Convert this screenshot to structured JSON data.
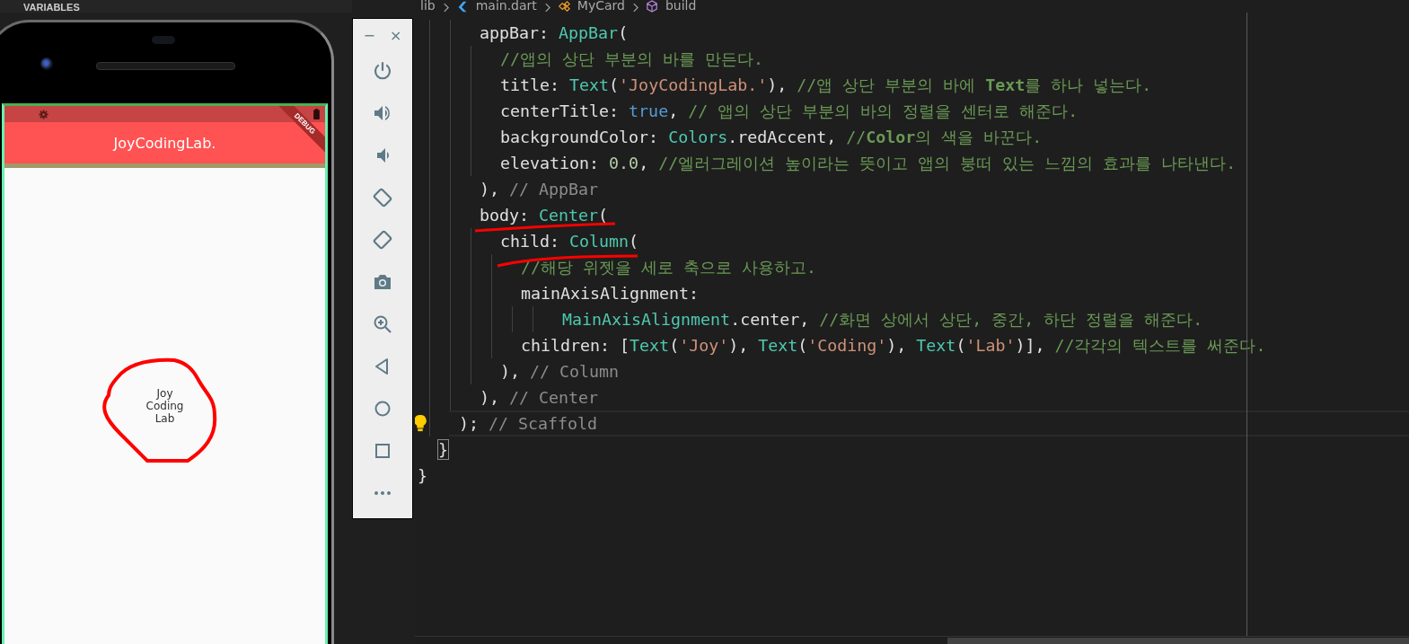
{
  "sidebar": {
    "header": "VARIABLES"
  },
  "breadcrumb": [
    {
      "label": "lib",
      "kind": "folder"
    },
    {
      "label": "main.dart",
      "kind": "file"
    },
    {
      "label": "MyCard",
      "kind": "class"
    },
    {
      "label": "build",
      "kind": "method"
    }
  ],
  "emulator": {
    "app_bar": {
      "title": "JoyCodingLab."
    },
    "debug_banner": "DEBUG",
    "body_texts": [
      "Joy",
      "Coding",
      "Lab"
    ]
  },
  "emulator_toolbar": {
    "minimize": "−",
    "close": "×",
    "buttons": [
      {
        "kind": "power"
      },
      {
        "kind": "volume-up"
      },
      {
        "kind": "volume-down"
      },
      {
        "kind": "rotate-left"
      },
      {
        "kind": "rotate-right"
      },
      {
        "kind": "camera"
      },
      {
        "kind": "zoom"
      },
      {
        "kind": "back"
      },
      {
        "kind": "home"
      },
      {
        "kind": "overview"
      },
      {
        "kind": "more"
      }
    ]
  },
  "editor": {
    "lines": [
      {
        "children": [
          {
            "children": [
              {
                "children": [
                  {
                    "tokens": [
                      {
                        "kind": "plain",
                        "t": "appBar: "
                      },
                      {
                        "kind": "type",
                        "t": "AppBar"
                      },
                      {
                        "kind": "plain",
                        "t": "("
                      }
                    ],
                    "children": [
                      {
                        "tokens": [
                          {
                            "kind": "comment",
                            "t": "//앱의 상단 부분의 바를 만든다."
                          }
                        ]
                      },
                      {
                        "tokens": [
                          {
                            "kind": "plain",
                            "t": "title: "
                          },
                          {
                            "kind": "type",
                            "t": "Text"
                          },
                          {
                            "kind": "plain",
                            "t": "("
                          },
                          {
                            "kind": "string",
                            "t": "'JoyCodingLab.'"
                          },
                          {
                            "kind": "plain",
                            "t": "), "
                          },
                          {
                            "kind": "comment",
                            "t": "//앱 상단 부분의 바에 **Text**를 하나 넣는다."
                          }
                        ]
                      },
                      {
                        "tokens": [
                          {
                            "kind": "plain",
                            "t": "centerTitle: "
                          },
                          {
                            "kind": "keyword",
                            "t": "true"
                          },
                          {
                            "kind": "plain",
                            "t": ", "
                          },
                          {
                            "kind": "comment",
                            "t": "// 앱의 상단 부분의 바의 정렬을 센터로 해준다."
                          }
                        ]
                      },
                      {
                        "tokens": [
                          {
                            "kind": "plain",
                            "t": "backgroundColor: "
                          },
                          {
                            "kind": "type",
                            "t": "Colors"
                          },
                          {
                            "kind": "plain",
                            "t": ".redAccent, "
                          },
                          {
                            "kind": "comment",
                            "t": "//**Color**의 색을 바꾼다."
                          }
                        ]
                      },
                      {
                        "tokens": [
                          {
                            "kind": "plain",
                            "t": "elevation: "
                          },
                          {
                            "kind": "number",
                            "t": "0.0"
                          },
                          {
                            "kind": "plain",
                            "t": ", "
                          },
                          {
                            "kind": "comment",
                            "t": "//엘러그레이션 높이라는 뜻이고 앱의 붕떠 있는 느낌의 효과를 나타낸다."
                          }
                        ]
                      }
                    ]
                  },
                  {
                    "tokens": [
                      {
                        "kind": "plain",
                        "t": "), "
                      },
                      {
                        "kind": "label",
                        "t": "// AppBar"
                      }
                    ]
                  },
                  {
                    "tokens": [
                      {
                        "kind": "plain",
                        "t": "body: "
                      },
                      {
                        "kind": "type",
                        "t": "Center"
                      },
                      {
                        "kind": "plain",
                        "t": "("
                      }
                    ],
                    "children": [
                      {
                        "tokens": [
                          {
                            "kind": "plain",
                            "t": "child: "
                          },
                          {
                            "kind": "type",
                            "t": "Column"
                          },
                          {
                            "kind": "plain",
                            "t": "("
                          }
                        ],
                        "children": [
                          {
                            "tokens": [
                              {
                                "kind": "comment",
                                "t": "//해당 위젯을 세로 축으로 사용하고."
                              }
                            ]
                          },
                          {
                            "tokens": [
                              {
                                "kind": "plain",
                                "t": "mainAxisAlignment:"
                              }
                            ],
                            "children": [
                              {
                                "children": [
                                  {
                                    "tokens": [
                                      {
                                        "kind": "type",
                                        "t": "MainAxisAlignment"
                                      },
                                      {
                                        "kind": "plain",
                                        "t": ".center, "
                                      },
                                      {
                                        "kind": "comment",
                                        "t": "//화면 상에서 상단, 중간, 하단 정렬을 해준다."
                                      }
                                    ]
                                  }
                                ]
                              }
                            ]
                          },
                          {
                            "tokens": [
                              {
                                "kind": "plain",
                                "t": "children: ["
                              },
                              {
                                "kind": "type",
                                "t": "Text"
                              },
                              {
                                "kind": "plain",
                                "t": "("
                              },
                              {
                                "kind": "string",
                                "t": "'Joy'"
                              },
                              {
                                "kind": "plain",
                                "t": "), "
                              },
                              {
                                "kind": "type",
                                "t": "Text"
                              },
                              {
                                "kind": "plain",
                                "t": "("
                              },
                              {
                                "kind": "string",
                                "t": "'Coding'"
                              },
                              {
                                "kind": "plain",
                                "t": "), "
                              },
                              {
                                "kind": "type",
                                "t": "Text"
                              },
                              {
                                "kind": "plain",
                                "t": "("
                              },
                              {
                                "kind": "string",
                                "t": "'Lab'"
                              },
                              {
                                "kind": "plain",
                                "t": ")], "
                              },
                              {
                                "kind": "comment",
                                "t": "//각각의 텍스트를 써준다."
                              }
                            ]
                          }
                        ]
                      },
                      {
                        "tokens": [
                          {
                            "kind": "plain",
                            "t": "), "
                          },
                          {
                            "kind": "label",
                            "t": "// Column"
                          }
                        ]
                      }
                    ]
                  },
                  {
                    "tokens": [
                      {
                        "kind": "plain",
                        "t": "), "
                      },
                      {
                        "kind": "label",
                        "t": "// Center"
                      }
                    ]
                  }
                ]
              },
              {
                "tokens": [
                  {
                    "kind": "plain",
                    "t": "); "
                  },
                  {
                    "kind": "label",
                    "t": "// Scaffold"
                  }
                ],
                "current": true
              }
            ]
          },
          {
            "tokens": [
              {
                "kind": "plain",
                "t": "}"
              }
            ],
            "bracket_match": true
          }
        ]
      },
      {
        "tokens": [
          {
            "kind": "plain",
            "t": "}"
          }
        ]
      }
    ]
  }
}
